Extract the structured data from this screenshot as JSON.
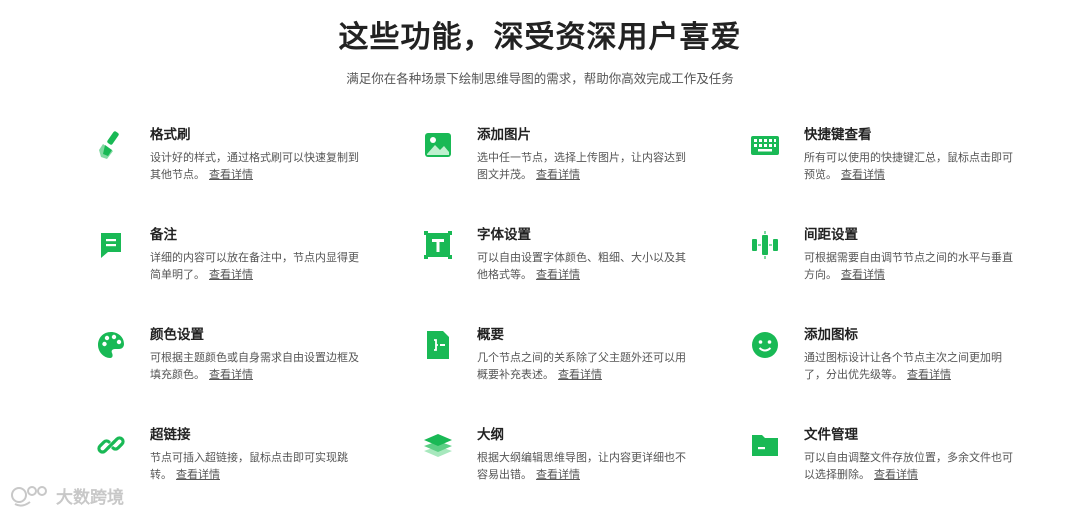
{
  "title": "这些功能，深受资深用户喜爱",
  "subtitle": "满足你在各种场景下绘制思维导图的需求，帮助你高效完成工作及任务",
  "accent_color": "#19b955",
  "features": [
    {
      "icon": "format-brush-icon",
      "name": "格式刷",
      "desc": "设计好的样式，通过格式刷可以快速复制到其他节点。",
      "link": "查看详情"
    },
    {
      "icon": "image-icon",
      "name": "添加图片",
      "desc": "选中任一节点，选择上传图片，让内容达到图文并茂。",
      "link": "查看详情"
    },
    {
      "icon": "keyboard-icon",
      "name": "快捷键查看",
      "desc": "所有可以使用的快捷键汇总，鼠标点击即可预览。",
      "link": "查看详情"
    },
    {
      "icon": "note-icon",
      "name": "备注",
      "desc": "详细的内容可以放在备注中，节点内显得更简单明了。",
      "link": "查看详情"
    },
    {
      "icon": "text-font-icon",
      "name": "字体设置",
      "desc": "可以自由设置字体颜色、粗细、大小以及其他格式等。",
      "link": "查看详情"
    },
    {
      "icon": "spacing-icon",
      "name": "间距设置",
      "desc": "可根据需要自由调节节点之间的水平与垂直方向。",
      "link": "查看详情"
    },
    {
      "icon": "palette-icon",
      "name": "颜色设置",
      "desc": "可根据主题颜色或自身需求自由设置边框及填充颜色。",
      "link": "查看详情"
    },
    {
      "icon": "summary-icon",
      "name": "概要",
      "desc": "几个节点之间的关系除了父主题外还可以用概要补充表述。",
      "link": "查看详情"
    },
    {
      "icon": "smiley-icon",
      "name": "添加图标",
      "desc": "通过图标设计让各个节点主次之间更加明了，分出优先级等。",
      "link": "查看详情"
    },
    {
      "icon": "link-icon",
      "name": "超链接",
      "desc": "节点可插入超链接，鼠标点击即可实现跳转。",
      "link": "查看详情"
    },
    {
      "icon": "outline-layers-icon",
      "name": "大纲",
      "desc": "根据大纲编辑思维导图，让内容更详细也不容易出错。",
      "link": "查看详情"
    },
    {
      "icon": "folder-icon",
      "name": "文件管理",
      "desc": "可以自由调整文件存放位置，多余文件也可以选择删除。",
      "link": "查看详情"
    }
  ],
  "watermark": "大数跨境"
}
